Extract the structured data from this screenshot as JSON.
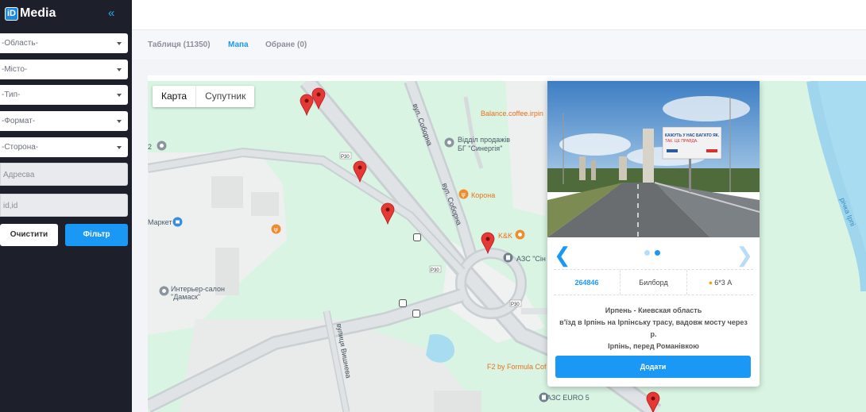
{
  "sidebar": {
    "logo_box": "iD",
    "logo_text": "Media",
    "collapse_icon": "«",
    "filters": [
      "-Область-",
      "-Місто-",
      "-Тип-",
      "-Формат-",
      "-Сторона-"
    ],
    "address_placeholder": "Адресва",
    "id_placeholder": "id,id",
    "clear_label": "Очистити",
    "filter_label": "Фільтр"
  },
  "tabs": {
    "table": "Таблиця (11350)",
    "map": "Мапа",
    "favorites": "Обране (0)"
  },
  "map": {
    "toggle_map": "Карта",
    "toggle_satellite": "Супутник",
    "labels": {
      "balance": "Balance.coffee.irpin",
      "sales": "Відділ продажів",
      "sales2": "БГ \"Синергія\"",
      "korona": "Корона",
      "kk": "K&K",
      "azs_sin": "АЗС \"Сін",
      "market": "Маркет",
      "interior": "Интерьер-салон",
      "interior2": "\"Дамаск\"",
      "f2": "F2 by Formula Cof",
      "azs_euro": "АЗС EURO 5",
      "num2": "2",
      "river": "річка Ірпі"
    },
    "roads": {
      "sobornaya1": "вул. Соборна",
      "sobornaya2": "вул. Соборна",
      "vyshneva": "вулиця Вишнева",
      "p30": "P30"
    }
  },
  "card": {
    "id": "264846",
    "type": "Билборд",
    "size": "6*3 А",
    "address_line1": "Ирпень - Киевская область",
    "address_line2": "в'їзд в Ірпінь на Ірпінську трасу, вадовж мосту через р.",
    "address_line3": "Ірпінь, перед Романівкою",
    "add_label": "Додати",
    "billboard_text1": "КАЖУТЬ У НАС БАГАТО ЯК.",
    "billboard_text2": "ТАК. ЦЕ ПРАВДА."
  },
  "colors": {
    "accent": "#1a98f5",
    "sidebar_bg": "#1d1f2b",
    "map_green": "#d9f4e3",
    "pin_red": "#e53935"
  }
}
